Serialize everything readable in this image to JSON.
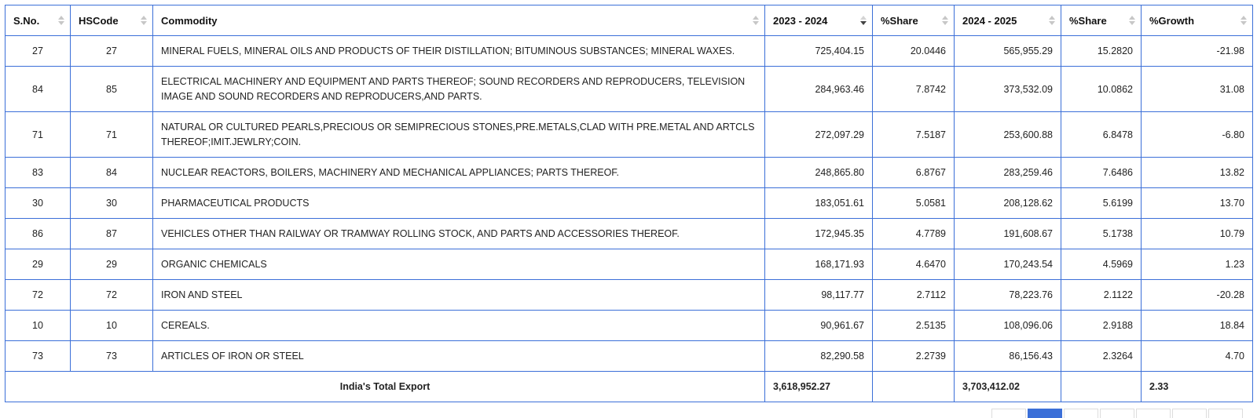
{
  "table": {
    "headers": [
      {
        "label": "S.No."
      },
      {
        "label": "HSCode"
      },
      {
        "label": "Commodity"
      },
      {
        "label": "2023 - 2024"
      },
      {
        "label": "%Share"
      },
      {
        "label": "2024 - 2025"
      },
      {
        "label": "%Share"
      },
      {
        "label": "%Growth"
      }
    ],
    "sorted_column": "2023 - 2024",
    "sort_direction": "descending",
    "rows": [
      {
        "sno": "27",
        "hscode": "27",
        "commodity": "MINERAL FUELS, MINERAL OILS AND PRODUCTS OF THEIR DISTILLATION; BITUMINOUS SUBSTANCES; MINERAL WAXES.",
        "y2023": "725,404.15",
        "share2023": "20.0446",
        "y2024": "565,955.29",
        "share2024": "15.2820",
        "growth": "-21.98"
      },
      {
        "sno": "84",
        "hscode": "85",
        "commodity": "ELECTRICAL MACHINERY AND EQUIPMENT AND PARTS THEREOF; SOUND RECORDERS AND REPRODUCERS, TELEVISION IMAGE AND SOUND RECORDERS AND REPRODUCERS,AND PARTS.",
        "y2023": "284,963.46",
        "share2023": "7.8742",
        "y2024": "373,532.09",
        "share2024": "10.0862",
        "growth": "31.08"
      },
      {
        "sno": "71",
        "hscode": "71",
        "commodity": "NATURAL OR CULTURED PEARLS,PRECIOUS OR SEMIPRECIOUS STONES,PRE.METALS,CLAD WITH PRE.METAL AND ARTCLS THEREOF;IMIT.JEWLRY;COIN.",
        "y2023": "272,097.29",
        "share2023": "7.5187",
        "y2024": "253,600.88",
        "share2024": "6.8478",
        "growth": "-6.80"
      },
      {
        "sno": "83",
        "hscode": "84",
        "commodity": "NUCLEAR REACTORS, BOILERS, MACHINERY AND MECHANICAL APPLIANCES; PARTS THEREOF.",
        "y2023": "248,865.80",
        "share2023": "6.8767",
        "y2024": "283,259.46",
        "share2024": "7.6486",
        "growth": "13.82"
      },
      {
        "sno": "30",
        "hscode": "30",
        "commodity": "PHARMACEUTICAL PRODUCTS",
        "y2023": "183,051.61",
        "share2023": "5.0581",
        "y2024": "208,128.62",
        "share2024": "5.6199",
        "growth": "13.70"
      },
      {
        "sno": "86",
        "hscode": "87",
        "commodity": "VEHICLES OTHER THAN RAILWAY OR TRAMWAY ROLLING STOCK, AND PARTS AND ACCESSORIES THEREOF.",
        "y2023": "172,945.35",
        "share2023": "4.7789",
        "y2024": "191,608.67",
        "share2024": "5.1738",
        "growth": "10.79"
      },
      {
        "sno": "29",
        "hscode": "29",
        "commodity": "ORGANIC CHEMICALS",
        "y2023": "168,171.93",
        "share2023": "4.6470",
        "y2024": "170,243.54",
        "share2024": "4.5969",
        "growth": "1.23"
      },
      {
        "sno": "72",
        "hscode": "72",
        "commodity": "IRON AND STEEL",
        "y2023": "98,117.77",
        "share2023": "2.7112",
        "y2024": "78,223.76",
        "share2024": "2.1122",
        "growth": "-20.28"
      },
      {
        "sno": "10",
        "hscode": "10",
        "commodity": "CEREALS.",
        "y2023": "90,961.67",
        "share2023": "2.5135",
        "y2024": "108,096.06",
        "share2024": "2.9188",
        "growth": "18.84"
      },
      {
        "sno": "73",
        "hscode": "73",
        "commodity": "ARTICLES OF IRON OR STEEL",
        "y2023": "82,290.58",
        "share2023": "2.2739",
        "y2024": "86,156.43",
        "share2024": "2.3264",
        "growth": "4.70"
      }
    ],
    "total": {
      "label": "India's Total Export",
      "y2023": "3,618,952.27",
      "share2023": "",
      "y2024": "3,703,412.02",
      "share2024": "",
      "growth": "2.33"
    }
  },
  "colors": {
    "border": "#3b6fd8",
    "sort_icon_inactive": "#c7c7c7",
    "sort_icon_active": "#444444"
  },
  "icons": {
    "sort": "sort-icon",
    "sort_desc": "sort-desc-icon"
  }
}
